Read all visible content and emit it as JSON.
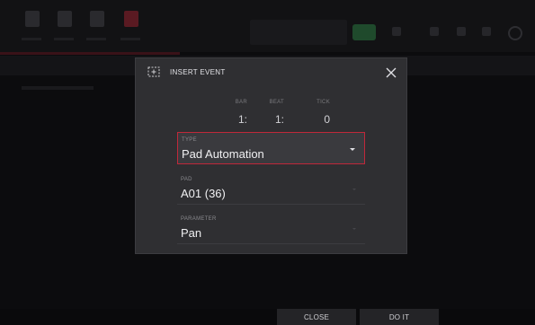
{
  "dialog": {
    "title": "INSERT EVENT",
    "position": {
      "bar": {
        "label": "BAR",
        "value": "1:"
      },
      "beat": {
        "label": "BEAT",
        "value": "1:"
      },
      "tick": {
        "label": "TICK",
        "value": "0"
      }
    },
    "fields": {
      "type": {
        "label": "TYPE",
        "value": "Pad Automation"
      },
      "pad": {
        "label": "PAD",
        "value": "A01 (36)"
      },
      "parameter": {
        "label": "PARAMETER",
        "value": "Pan"
      }
    }
  },
  "footer": {
    "close_label": "CLOSE",
    "do_it_label": "DO IT"
  },
  "colors": {
    "accent_red": "#c0283a",
    "modal_bg": "#2f2f32",
    "backdrop": "#0c0c0e"
  },
  "icons": {
    "title_icon": "insert-event-icon",
    "close": "close-icon",
    "dropdown": "chevron-down-icon"
  }
}
